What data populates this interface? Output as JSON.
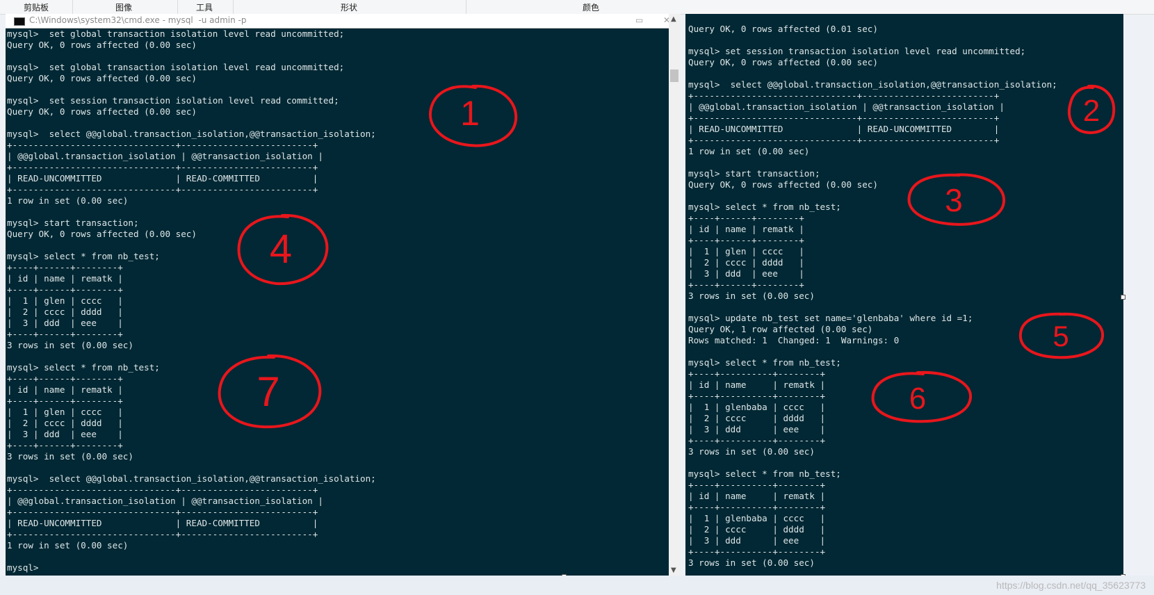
{
  "ribbon": {
    "groups": [
      "剪贴板",
      "图像",
      "工具",
      "形状",
      "颜色"
    ]
  },
  "left_window": {
    "title": "C:\\Windows\\system32\\cmd.exe - mysql  -u admin -p",
    "min_glyph": "▭",
    "close_glyph": "✕",
    "lines": [
      "mysql>  set global transaction isolation level read uncommitted;",
      "Query OK, 0 rows affected (0.00 sec)",
      "",
      "mysql>  set global transaction isolation level read uncommitted;",
      "Query OK, 0 rows affected (0.00 sec)",
      "",
      "mysql>  set session transaction isolation level read committed;",
      "Query OK, 0 rows affected (0.00 sec)",
      "",
      "mysql>  select @@global.transaction_isolation,@@transaction_isolation;",
      "+-------------------------------+-------------------------+",
      "| @@global.transaction_isolation | @@transaction_isolation |",
      "+-------------------------------+-------------------------+",
      "| READ-UNCOMMITTED              | READ-COMMITTED          |",
      "+-------------------------------+-------------------------+",
      "1 row in set (0.00 sec)",
      "",
      "mysql> start transaction;",
      "Query OK, 0 rows affected (0.00 sec)",
      "",
      "mysql> select * from nb_test;",
      "+----+------+--------+",
      "| id | name | rematk |",
      "+----+------+--------+",
      "|  1 | glen | cccc   |",
      "|  2 | cccc | dddd   |",
      "|  3 | ddd  | eee    |",
      "+----+------+--------+",
      "3 rows in set (0.00 sec)",
      "",
      "mysql> select * from nb_test;",
      "+----+------+--------+",
      "| id | name | rematk |",
      "+----+------+--------+",
      "|  1 | glen | cccc   |",
      "|  2 | cccc | dddd   |",
      "|  3 | ddd  | eee    |",
      "+----+------+--------+",
      "3 rows in set (0.00 sec)",
      "",
      "mysql>  select @@global.transaction_isolation,@@transaction_isolation;",
      "+-------------------------------+-------------------------+",
      "| @@global.transaction_isolation | @@transaction_isolation |",
      "+-------------------------------+-------------------------+",
      "| READ-UNCOMMITTED              | READ-COMMITTED          |",
      "+-------------------------------+-------------------------+",
      "1 row in set (0.00 sec)",
      "",
      "mysql>"
    ]
  },
  "right_window": {
    "lines": [
      "Query OK, 0 rows affected (0.01 sec)",
      "",
      "mysql> set session transaction isolation level read uncommitted;",
      "Query OK, 0 rows affected (0.00 sec)",
      "",
      "mysql>  select @@global.transaction_isolation,@@transaction_isolation;",
      "+-------------------------------+-------------------------+",
      "| @@global.transaction_isolation | @@transaction_isolation |",
      "+-------------------------------+-------------------------+",
      "| READ-UNCOMMITTED              | READ-UNCOMMITTED        |",
      "+-------------------------------+-------------------------+",
      "1 row in set (0.00 sec)",
      "",
      "mysql> start transaction;",
      "Query OK, 0 rows affected (0.00 sec)",
      "",
      "mysql> select * from nb_test;",
      "+----+------+--------+",
      "| id | name | rematk |",
      "+----+------+--------+",
      "|  1 | glen | cccc   |",
      "|  2 | cccc | dddd   |",
      "|  3 | ddd  | eee    |",
      "+----+------+--------+",
      "3 rows in set (0.00 sec)",
      "",
      "mysql> update nb_test set name='glenbaba' where id =1;",
      "Query OK, 1 row affected (0.00 sec)",
      "Rows matched: 1  Changed: 1  Warnings: 0",
      "",
      "mysql> select * from nb_test;",
      "+----+----------+--------+",
      "| id | name     | rematk |",
      "+----+----------+--------+",
      "|  1 | glenbaba | cccc   |",
      "|  2 | cccc     | dddd   |",
      "|  3 | ddd      | eee    |",
      "+----+----------+--------+",
      "3 rows in set (0.00 sec)",
      "",
      "mysql> select * from nb_test;",
      "+----+----------+--------+",
      "| id | name     | rematk |",
      "+----+----------+--------+",
      "|  1 | glenbaba | cccc   |",
      "|  2 | cccc     | dddd   |",
      "|  3 | ddd      | eee    |",
      "+----+----------+--------+",
      "3 rows in set (0.00 sec)"
    ]
  },
  "annotations": [
    "1",
    "2",
    "3",
    "4",
    "5",
    "6",
    "7"
  ],
  "watermark": "https://blog.csdn.net/qq_35623773",
  "colors": {
    "console_bg": "#012834",
    "console_text": "#dfe6e8",
    "annotation_red": "#e8161c"
  },
  "scrollbar": {
    "up_glyph": "▲",
    "down_glyph": "▼"
  }
}
